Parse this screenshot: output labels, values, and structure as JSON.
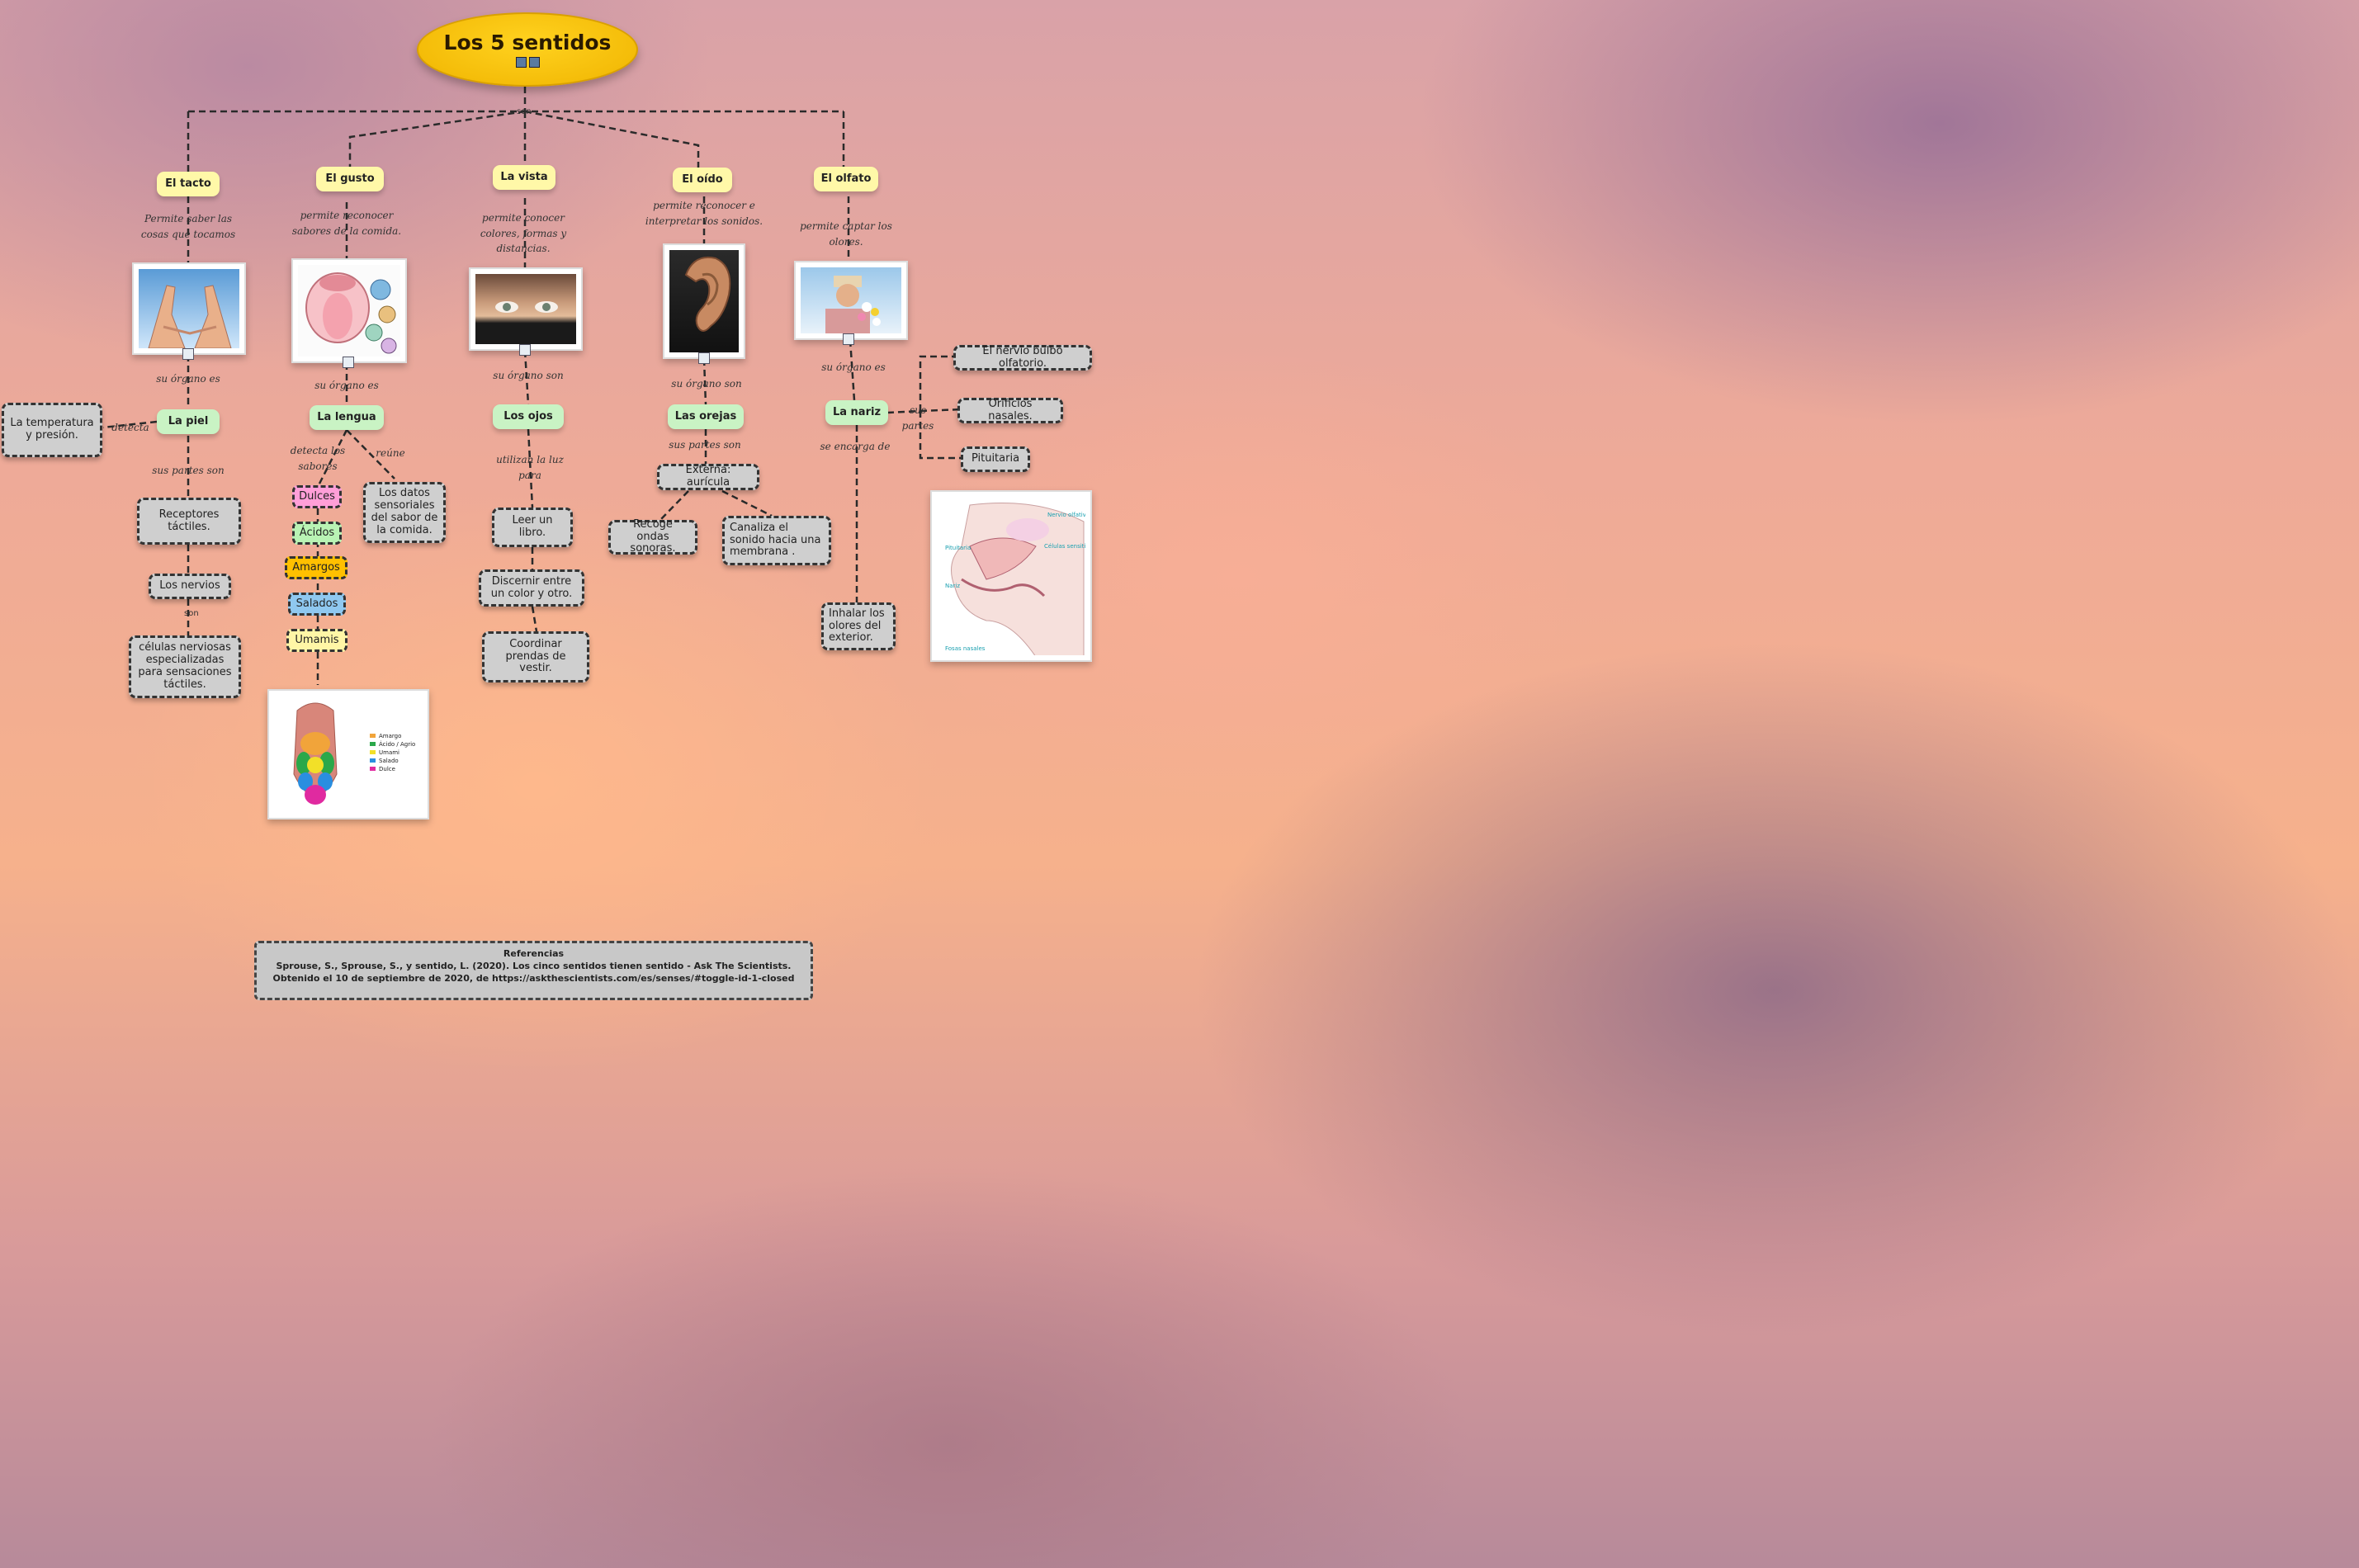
{
  "title": "Los 5 sentidos",
  "connector": "son",
  "senses": {
    "tacto": {
      "label": "El tacto",
      "desc": "Permite saber las cosas que tocamos",
      "organ_link": "su órgano es",
      "organ": "La piel",
      "detect_link": "detecta",
      "detects": "La temperatura y presión.",
      "parts_link": "sus partes son",
      "parts": [
        "Receptores táctiles.",
        "Los nervios"
      ],
      "nerves_link": "son",
      "nerves_desc": "células nerviosas especializadas para sensaciones táctiles."
    },
    "gusto": {
      "label": "El gusto",
      "desc": "permite reconocer sabores de la comida.",
      "organ_link": "su órgano es",
      "organ": "La lengua",
      "flavors_link": "detecta los sabores",
      "flavors": [
        "Dulces",
        "Ácidos",
        "Amargos",
        "Salados",
        "Umamis"
      ],
      "gather_link": "reúne",
      "gather": "Los datos sensoriales del sabor de la comida.",
      "tongue_legend": [
        "Amargo",
        "Ácido / Agrio",
        "Umami",
        "Salado",
        "Dulce"
      ]
    },
    "vista": {
      "label": "La vista",
      "desc": "permite conocer colores, formas y distancias.",
      "organ_link": "su órgano son",
      "organ": "Los ojos",
      "use_link": "utilizan la luz para",
      "uses": [
        "Leer un libro.",
        "Discernir entre un color y otro.",
        "Coordinar prendas de vestir."
      ]
    },
    "oido": {
      "label": "El oído",
      "desc": "permite reconocer e interpretar los sonidos.",
      "organ_link": "su órgano son",
      "organ": "Las orejas",
      "parts_link": "sus partes son",
      "part": "Externa: aurícula",
      "functions": [
        "Recoge ondas sonoras.",
        "Canaliza el sonido hacia una membrana ."
      ]
    },
    "olfato": {
      "label": "El olfato",
      "desc": "permite captar los olores.",
      "organ_link": "su órgano es",
      "organ": "La nariz",
      "parts_link": "sus partes",
      "parts": [
        "El nervio bulbo olfatorio.",
        "Orificios nasales.",
        "Pituitaria"
      ],
      "task_link": "se encarga de",
      "task": "Inhalar los olores del exterior.",
      "diagram_labels": [
        "Nervio olfativo",
        "Pituitaria",
        "Células sensitivas",
        "Nariz",
        "Fosas nasales"
      ]
    }
  },
  "references": {
    "heading": "Referencias",
    "text": "Sprouse, S., Sprouse, S., y sentido, L. (2020). Los cinco sentidos tienen sentido - Ask The Scientists. Obtenido el 10 de septiembre de 2020, de https://askthescientists.com/es/senses/#toggle-id-1-closed"
  }
}
